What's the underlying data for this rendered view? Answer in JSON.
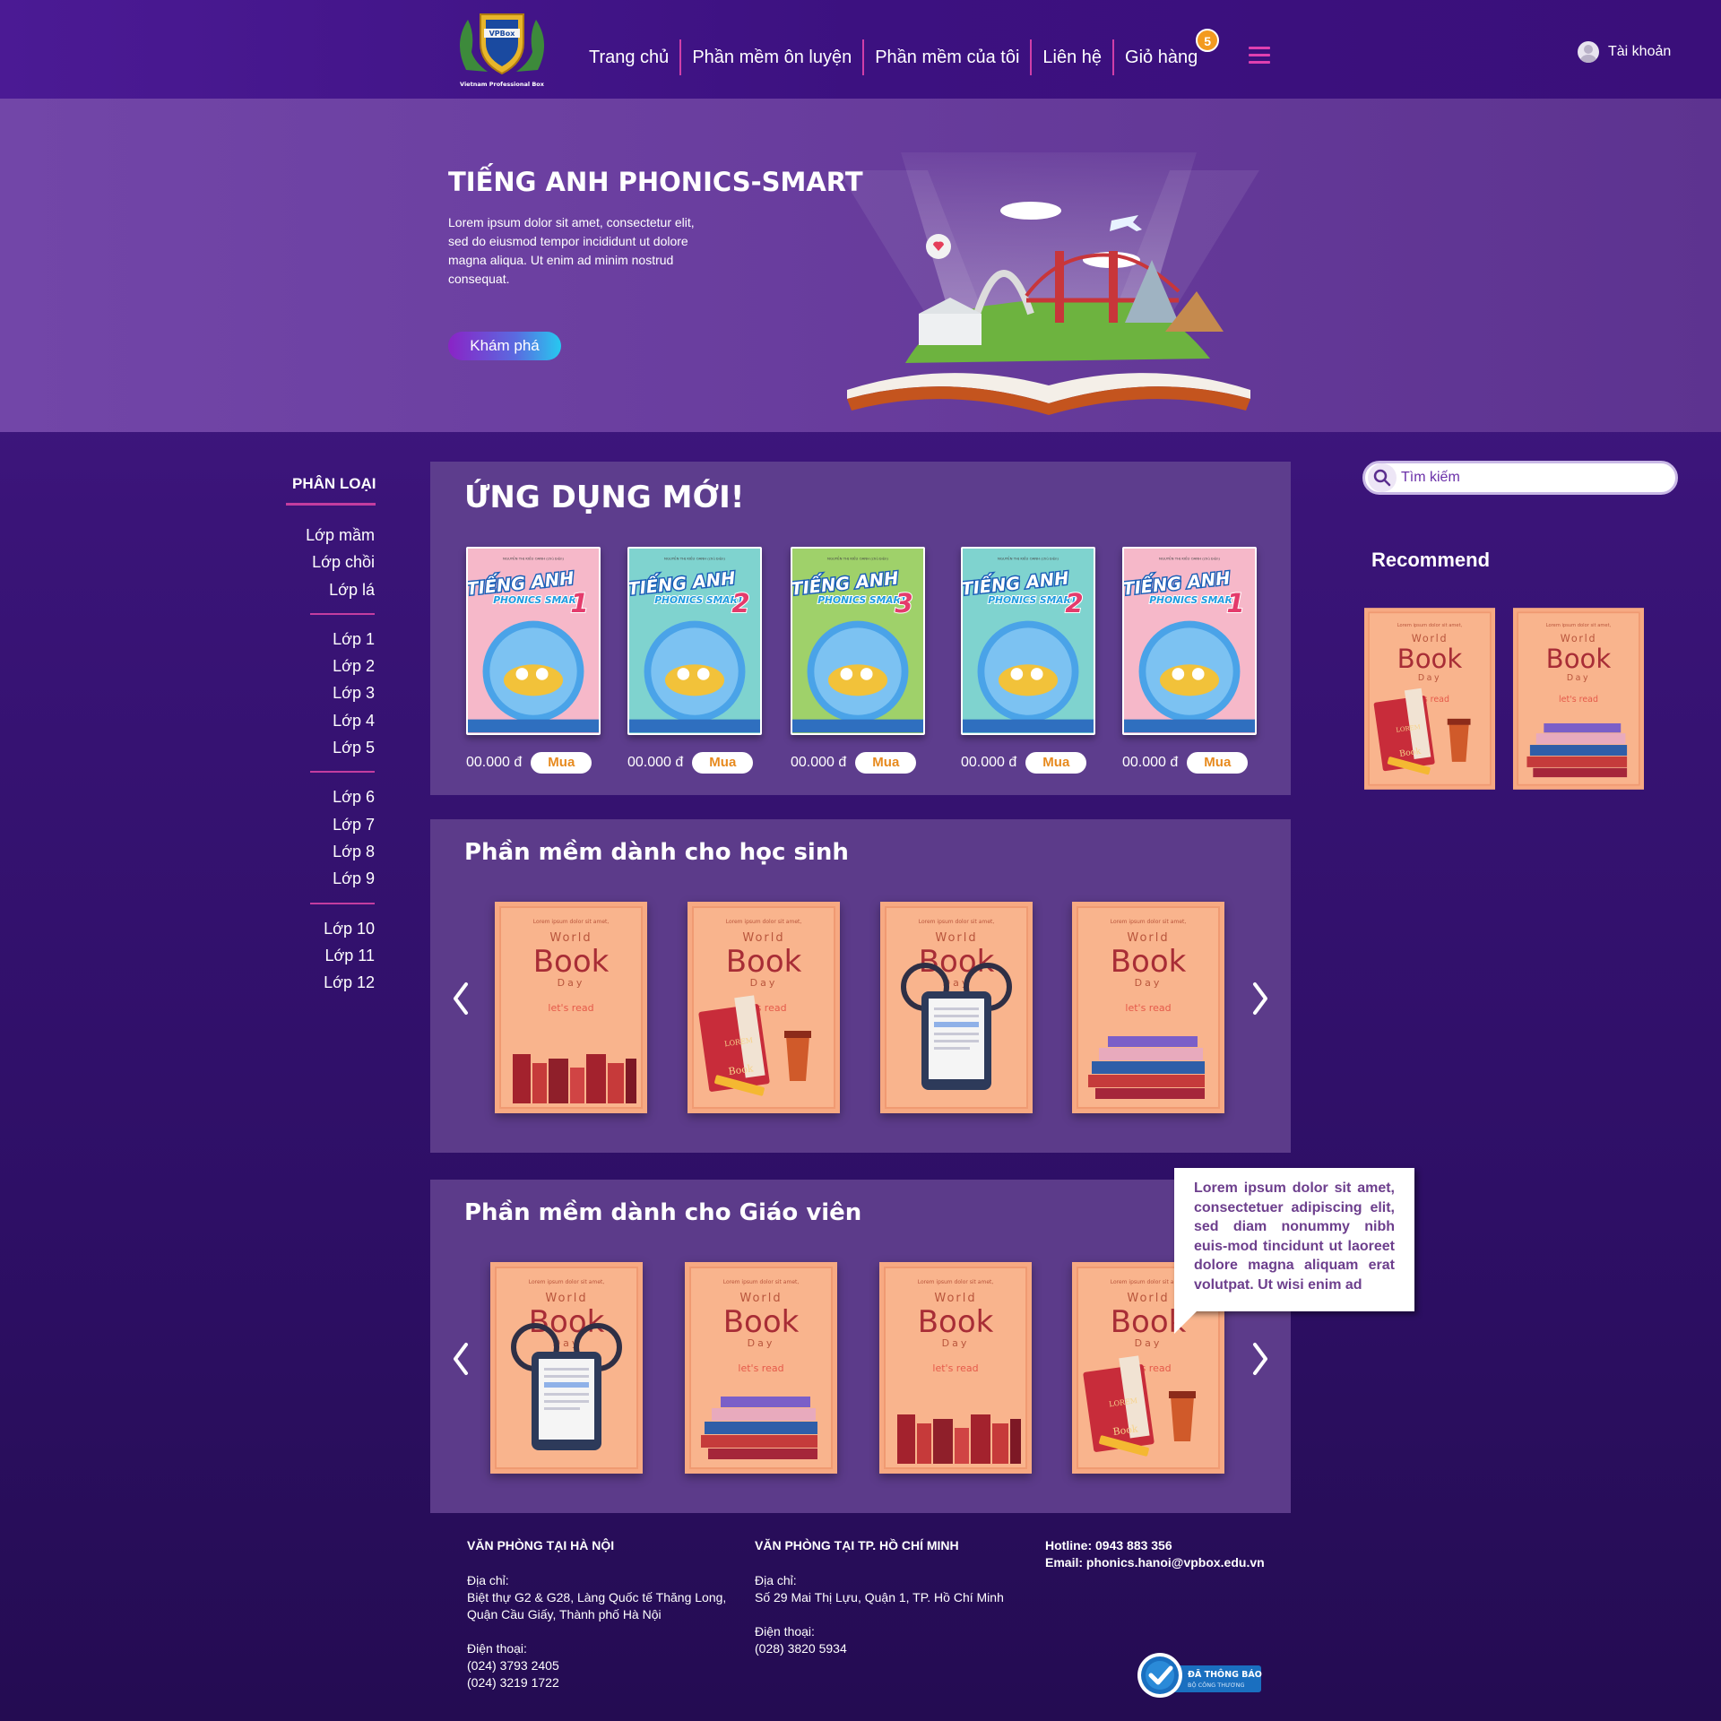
{
  "header": {
    "logo_text": "Vietnam Professional Box",
    "nav": [
      "Trang chủ",
      "Phần mềm ôn luyện",
      "Phần mềm của tôi",
      "Liên hệ",
      "Giỏ hàng"
    ],
    "cart_count": "5",
    "account_label": "Tài khoản"
  },
  "hero": {
    "title": "TIẾNG ANH PHONICS-SMART",
    "description": "Lorem ipsum dolor sit amet, consectetur elit, sed do eiusmod tempor incididunt ut dolore magna aliqua. Ut enim ad minim nostrud consequat.",
    "button_label": "Khám phá"
  },
  "sidebar": {
    "title": "PHÂN LOẠI",
    "groups": [
      [
        "Lớp mầm",
        "Lớp chồi",
        "Lớp lá"
      ],
      [
        "Lớp 1",
        "Lớp 2",
        "Lớp 3",
        "Lớp 4",
        "Lớp 5"
      ],
      [
        "Lớp 6",
        "Lớp 7",
        "Lớp 8",
        "Lớp 9"
      ],
      [
        "Lớp 10",
        "Lớp 11",
        "Lớp 12"
      ]
    ]
  },
  "new_apps": {
    "title": "ỨNG DỤNG MỚI!",
    "buy_label": "Mua",
    "products": [
      {
        "cover_title": "TIẾNG ANH",
        "cover_sub": "PHONICS SMART",
        "grade": "1",
        "price": "00.000 đ",
        "color": "#f6b8c9"
      },
      {
        "cover_title": "TIẾNG ANH",
        "cover_sub": "PHONICS SMART",
        "grade": "2",
        "price": "00.000 đ",
        "color": "#7fd3cf"
      },
      {
        "cover_title": "TIẾNG ANH",
        "cover_sub": "PHONICS SMART",
        "grade": "3",
        "price": "00.000 đ",
        "color": "#9fd16a"
      },
      {
        "cover_title": "TIẾNG ANH",
        "cover_sub": "PHONICS SMART",
        "grade": "2",
        "price": "00.000 đ",
        "color": "#7fd3cf"
      },
      {
        "cover_title": "TIẾNG ANH",
        "cover_sub": "PHONICS SMART",
        "grade": "1",
        "price": "00.000 đ",
        "color": "#f6b8c9"
      }
    ]
  },
  "student_section": {
    "title": "Phần mềm dành cho học sinh",
    "books": [
      {
        "top": "World",
        "big": "Book",
        "sub": "Day",
        "tag": "let's read",
        "art": "shelf"
      },
      {
        "top": "World",
        "big": "Book",
        "sub": "Day",
        "tag": "let's read",
        "art": "coffee"
      },
      {
        "top": "World",
        "big": "Book",
        "sub": "Day",
        "tag": "let's read",
        "art": "tablet"
      },
      {
        "top": "World",
        "big": "Book",
        "sub": "Day",
        "tag": "let's read",
        "art": "stack"
      }
    ]
  },
  "teacher_section": {
    "title": "Phần mềm dành cho Giáo viên",
    "books": [
      {
        "top": "World",
        "big": "Book",
        "sub": "Day",
        "tag": "let's read",
        "art": "tablet"
      },
      {
        "top": "World",
        "big": "Book",
        "sub": "Day",
        "tag": "let's read",
        "art": "stack"
      },
      {
        "top": "World",
        "big": "Book",
        "sub": "Day",
        "tag": "let's read",
        "art": "shelf"
      },
      {
        "top": "World",
        "big": "Book",
        "sub": "Day",
        "tag": "let's read",
        "art": "coffee"
      }
    ]
  },
  "search": {
    "placeholder": "Tìm kiếm"
  },
  "recommend": {
    "title": "Recommend",
    "books": [
      {
        "top": "World",
        "big": "Book",
        "sub": "Day",
        "tag": "let's read",
        "art": "coffee"
      },
      {
        "top": "World",
        "big": "Book",
        "sub": "Day",
        "tag": "let's read",
        "art": "stack"
      }
    ]
  },
  "tooltip": {
    "text": "Lorem ipsum dolor sit amet, consectetuer adipiscing elit, sed diam nonummy nibh euis-mod tincidunt ut laoreet dolore magna aliquam erat volutpat. Ut wisi enim ad"
  },
  "footer": {
    "hanoi": {
      "title": "VĂN PHÒNG TẠI HÀ NỘI",
      "address_label": "Địa chỉ:",
      "address": [
        "Biệt thự G2 & G28, Làng Quốc tế Thăng Long,",
        "Quận Cầu Giấy, Thành phố Hà Nội"
      ],
      "phone_label": "Điện thoại:",
      "phones": [
        "(024) 3793 2405",
        "(024) 3219 1722"
      ]
    },
    "hcm": {
      "title": "VĂN PHÒNG TẠI TP. HỒ CHÍ MINH",
      "address_label": "Địa chỉ:",
      "address": [
        "Số 29 Mai Thị Lựu, Quận 1, TP. Hồ Chí Minh"
      ],
      "phone_label": "Điện thoại:",
      "phones": [
        "(028) 3820 5934"
      ]
    },
    "hotline": "Hotline: 0943 883 356",
    "email": "Email: phonics.hanoi@vpbox.edu.vn",
    "badge_title": "ĐÃ THÔNG BÁO",
    "badge_sub": "BỘ CÔNG THƯƠNG"
  },
  "colors": {
    "accent_pink": "#c43da0",
    "cart_badge": "#f39a1f",
    "buy_text": "#e78a1e",
    "panel_bg": "#5c3b8a",
    "book_cover": "#f7a982"
  }
}
